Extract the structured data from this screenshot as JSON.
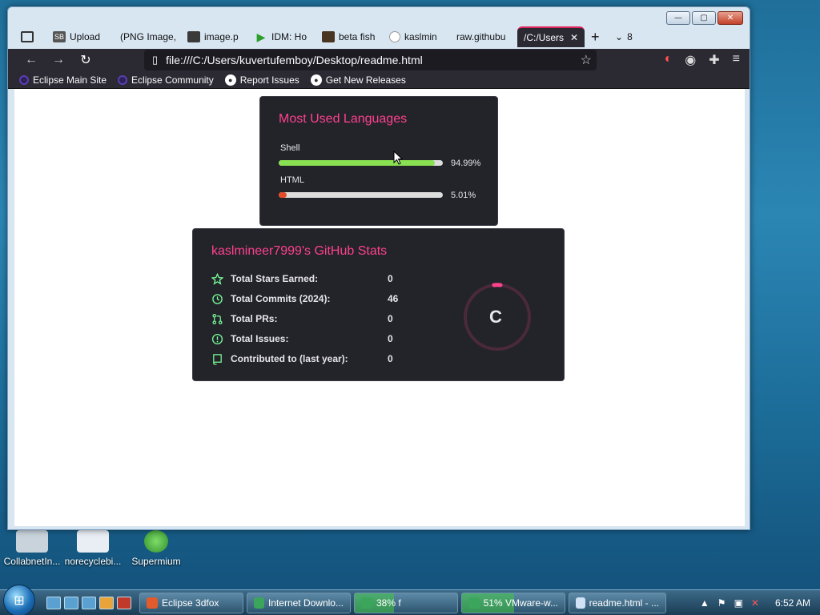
{
  "desktop": {
    "icons": [
      {
        "label": "CollabnetIn..."
      },
      {
        "label": "norecyclebi..."
      },
      {
        "label": "Supermium"
      }
    ]
  },
  "browser": {
    "window_controls": {
      "minimize": "—",
      "maximize": "▢",
      "close": "✕"
    },
    "tabs": [
      {
        "label": "",
        "icon": "tab-overview-icon"
      },
      {
        "label": "Upload",
        "icon": "sb-icon"
      },
      {
        "label": "(PNG Image,",
        "icon": ""
      },
      {
        "label": "image.p",
        "icon": "image-icon"
      },
      {
        "label": "IDM: Ho",
        "icon": "idm-icon"
      },
      {
        "label": "beta fish",
        "icon": "image-icon"
      },
      {
        "label": "kaslmin",
        "icon": "github-icon"
      },
      {
        "label": "raw.githubu",
        "icon": ""
      },
      {
        "label": "/C:/Users",
        "icon": "",
        "active": true
      }
    ],
    "new_tab": "+",
    "tab_count": "8",
    "url": "file:///C:/Users/kuvertufemboy/Desktop/readme.html",
    "bookmarks": [
      {
        "label": "Eclipse Main Site",
        "icon": "eclipse-icon"
      },
      {
        "label": "Eclipse Community",
        "icon": "eclipse-icon"
      },
      {
        "label": "Report Issues",
        "icon": "github-icon"
      },
      {
        "label": "Get New Releases",
        "icon": "github-icon"
      }
    ]
  },
  "languages_card": {
    "title": "Most Used Languages",
    "items": [
      {
        "name": "Shell",
        "percent_label": "94.99%",
        "fraction": 0.9499,
        "color": "#89e051"
      },
      {
        "name": "HTML",
        "percent_label": "5.01%",
        "fraction": 0.0501,
        "color": "#e34c26"
      }
    ]
  },
  "stats_card": {
    "title": "kaslmineer7999's GitHub Stats",
    "rows": [
      {
        "label": "Total Stars Earned:",
        "value": "0",
        "icon": "star-icon"
      },
      {
        "label": "Total Commits (2024):",
        "value": "46",
        "icon": "history-icon"
      },
      {
        "label": "Total PRs:",
        "value": "0",
        "icon": "pull-request-icon"
      },
      {
        "label": "Total Issues:",
        "value": "0",
        "icon": "issue-icon"
      },
      {
        "label": "Contributed to (last year):",
        "value": "0",
        "icon": "repo-icon"
      }
    ],
    "rank": "C"
  },
  "taskbar": {
    "tasks": [
      {
        "label": "Eclipse 3dfox",
        "progress": 0
      },
      {
        "label": "Internet Downlo...",
        "progress": 0
      },
      {
        "label": "38% f",
        "progress": 0.38
      },
      {
        "label": "51% VMware-w...",
        "progress": 0.51
      },
      {
        "label": "readme.html - ...",
        "progress": 0
      }
    ],
    "clock": "6:52 AM"
  },
  "colors": {
    "card_bg": "#23232a",
    "title_pink": "#fe428e",
    "accent_green": "#79ff97"
  }
}
